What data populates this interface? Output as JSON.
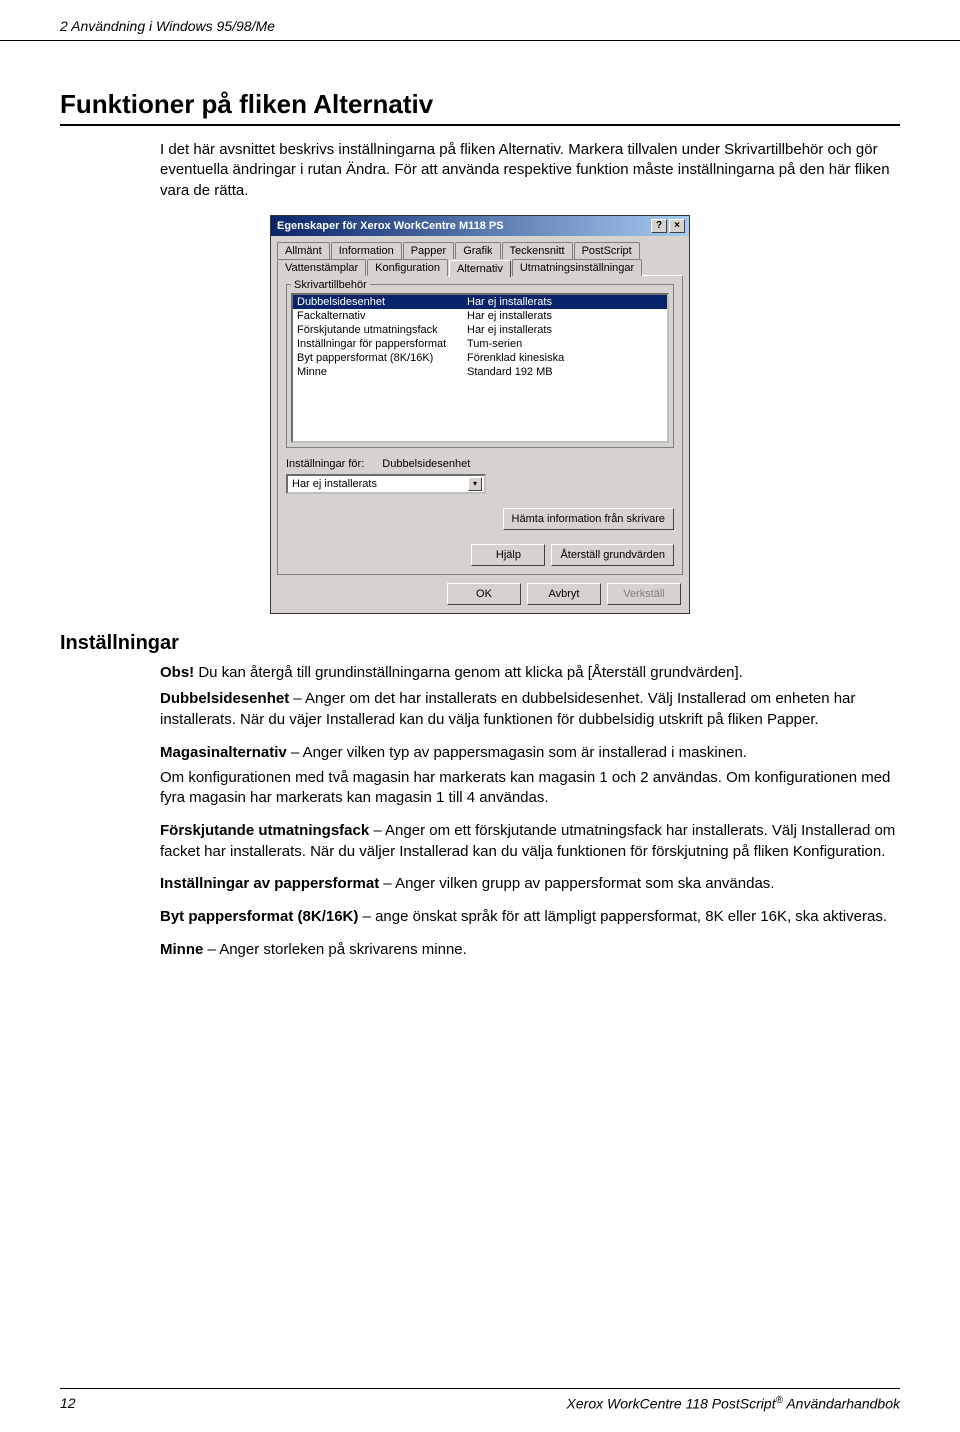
{
  "header": {
    "chapter": "2  Användning i Windows 95/98/Me"
  },
  "section": {
    "title": "Funktioner på fliken Alternativ"
  },
  "intro": {
    "p1": "I det här avsnittet beskrivs inställningarna på fliken Alternativ. Markera tillvalen under Skrivartillbehör och gör eventuella ändringar i rutan Ändra. För att använda respektive funktion måste inställningarna på den här fliken vara de rätta."
  },
  "dialog": {
    "title": "Egenskaper för Xerox WorkCentre M118 PS",
    "help_icon": "?",
    "close_icon": "×",
    "tabs_row1": [
      "Allmänt",
      "Information",
      "Papper",
      "Grafik",
      "Teckensnitt",
      "PostScript"
    ],
    "tabs_row2": [
      "Vattenstämplar",
      "Konfiguration",
      "Alternativ",
      "Utmatningsinställningar"
    ],
    "active_tab": "Alternativ",
    "group_label": "Skrivartillbehör",
    "list": [
      {
        "c1": "Dubbelsidesenhet",
        "c2": "Har ej installerats",
        "sel": true
      },
      {
        "c1": "Fackalternativ",
        "c2": "Har ej installerats"
      },
      {
        "c1": "Förskjutande utmatningsfack",
        "c2": "Har ej installerats"
      },
      {
        "c1": "Inställningar för pappersformat",
        "c2": "Tum-serien"
      },
      {
        "c1": "Byt pappersformat (8K/16K)",
        "c2": "Förenklad kinesiska"
      },
      {
        "c1": "Minne",
        "c2": "Standard 192 MB"
      }
    ],
    "settings_for_label": "Inställningar för:",
    "settings_for_value": "Dubbelsidesenhet",
    "combo_value": "Har ej installerats",
    "btn_fetch": "Hämta information från skrivare",
    "btn_help": "Hjälp",
    "btn_reset": "Återställ grundvärden",
    "btn_ok": "OK",
    "btn_cancel": "Avbryt",
    "btn_apply": "Verkställ"
  },
  "subsection": {
    "title": "Inställningar"
  },
  "note": {
    "bold": "Obs!",
    "text": " Du kan återgå till grundinställningarna genom att klicka på [Återställ grundvärden]."
  },
  "settings": {
    "p1b": "Dubbelsidesenhet",
    "p1": " – Anger om det har installerats en dubbelsidesenhet. Välj Installerad om enheten har installerats. När du väjer Installerad kan du välja funktionen för dubbelsidig utskrift på fliken Papper.",
    "p2b": "Magasinalternativ",
    "p2a": " – Anger vilken typ av pappersmagasin som är installerad i maskinen.",
    "p2c": "Om konfigurationen med två magasin har markerats kan magasin 1 och 2 användas. Om konfigurationen med fyra magasin har markerats kan magasin 1 till 4 användas.",
    "p3b": "Förskjutande utmatningsfack",
    "p3": " – Anger om ett förskjutande utmatningsfack har installerats. Välj Installerad om facket har installerats. När du väljer Installerad kan du välja funktionen för förskjutning på fliken Konfiguration.",
    "p4b": "Inställningar av pappersformat",
    "p4": " – Anger vilken grupp av pappersformat som ska användas.",
    "p5b": "Byt pappersformat (8K/16K)",
    "p5": " – ange önskat språk för att lämpligt pappersformat, 8K eller 16K, ska aktiveras.",
    "p6b": "Minne",
    "p6": " – Anger storleken på skrivarens minne."
  },
  "footer": {
    "page": "12",
    "doc_a": "Xerox WorkCentre 118 PostScript",
    "doc_sup": "®",
    "doc_b": " Användarhandbok"
  }
}
